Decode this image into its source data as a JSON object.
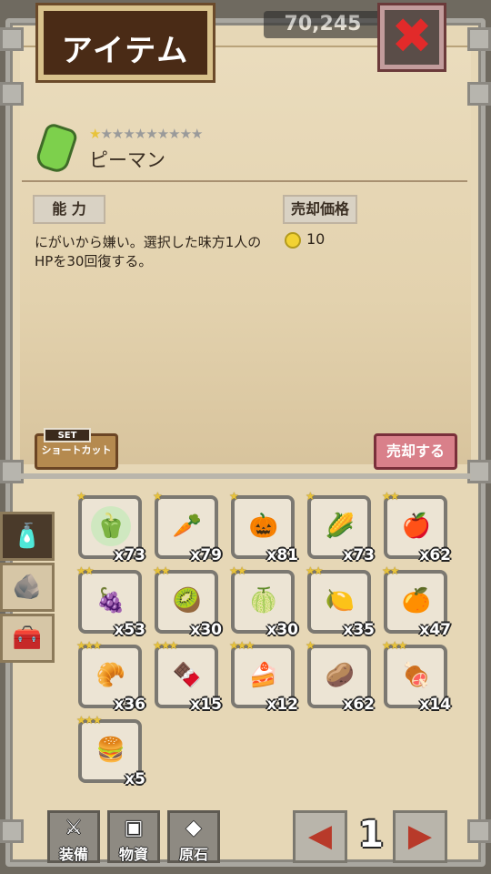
{
  "header": {
    "title": "アイテム",
    "score": "70,245"
  },
  "selected_item": {
    "name": "ピーマン",
    "rarity_filled": "★",
    "rarity_empty": "★★★★★★★★★",
    "ability_label": "能 力",
    "sell_price_label": "売却価格",
    "description": "にがいから嫌い。選択した味方1人のHPを30回復する。",
    "price": "10"
  },
  "buttons": {
    "set_label": "SET",
    "shortcut_label": "ショートカット",
    "sell_label": "売却する"
  },
  "items": [
    {
      "stars": "★",
      "qty": "x73",
      "icon": "green-pepper-icon",
      "glyph": "🫑",
      "bg": "#cfe8c0"
    },
    {
      "stars": "★",
      "qty": "x79",
      "icon": "carrot-icon",
      "glyph": "🥕",
      "bg": "#ece4d4"
    },
    {
      "stars": "★",
      "qty": "x81",
      "icon": "pumpkin-icon",
      "glyph": "🎃",
      "bg": "#ece4d4"
    },
    {
      "stars": "★",
      "qty": "x73",
      "icon": "corn-icon",
      "glyph": "🌽",
      "bg": "#ece4d4"
    },
    {
      "stars": "★★",
      "qty": "x62",
      "icon": "apple-icon",
      "glyph": "🍎",
      "bg": "#ece4d4"
    },
    {
      "stars": "★★",
      "qty": "x53",
      "icon": "grapes-icon",
      "glyph": "🍇",
      "bg": "#ece4d4"
    },
    {
      "stars": "★★",
      "qty": "x30",
      "icon": "kiwi-icon",
      "glyph": "🥝",
      "bg": "#ece4d4"
    },
    {
      "stars": "★★",
      "qty": "x30",
      "icon": "melon-icon",
      "glyph": "🍈",
      "bg": "#ece4d4"
    },
    {
      "stars": "★★",
      "qty": "x35",
      "icon": "lemon-icon",
      "glyph": "🍋",
      "bg": "#ece4d4"
    },
    {
      "stars": "★★",
      "qty": "x47",
      "icon": "orange-icon",
      "glyph": "🍊",
      "bg": "#ece4d4"
    },
    {
      "stars": "★★★",
      "qty": "x36",
      "icon": "bread-icon",
      "glyph": "🥐",
      "bg": "#ece4d4"
    },
    {
      "stars": "★★★",
      "qty": "x15",
      "icon": "chocolate-icon",
      "glyph": "🍫",
      "bg": "#ece4d4"
    },
    {
      "stars": "★★★",
      "qty": "x12",
      "icon": "cake-icon",
      "glyph": "🍰",
      "bg": "#ece4d4"
    },
    {
      "stars": "★",
      "qty": "x62",
      "icon": "potato-icon",
      "glyph": "🥔",
      "bg": "#ece4d4"
    },
    {
      "stars": "★★★",
      "qty": "x14",
      "icon": "meat-icon",
      "glyph": "🍖",
      "bg": "#ece4d4"
    },
    {
      "stars": "★★★",
      "qty": "x5",
      "icon": "hamburger-icon",
      "glyph": "🍔",
      "bg": "#ece4d4"
    }
  ],
  "bottom_nav": {
    "equip_label": "装備",
    "materials_label": "物資",
    "gems_label": "原石",
    "page": "1"
  }
}
